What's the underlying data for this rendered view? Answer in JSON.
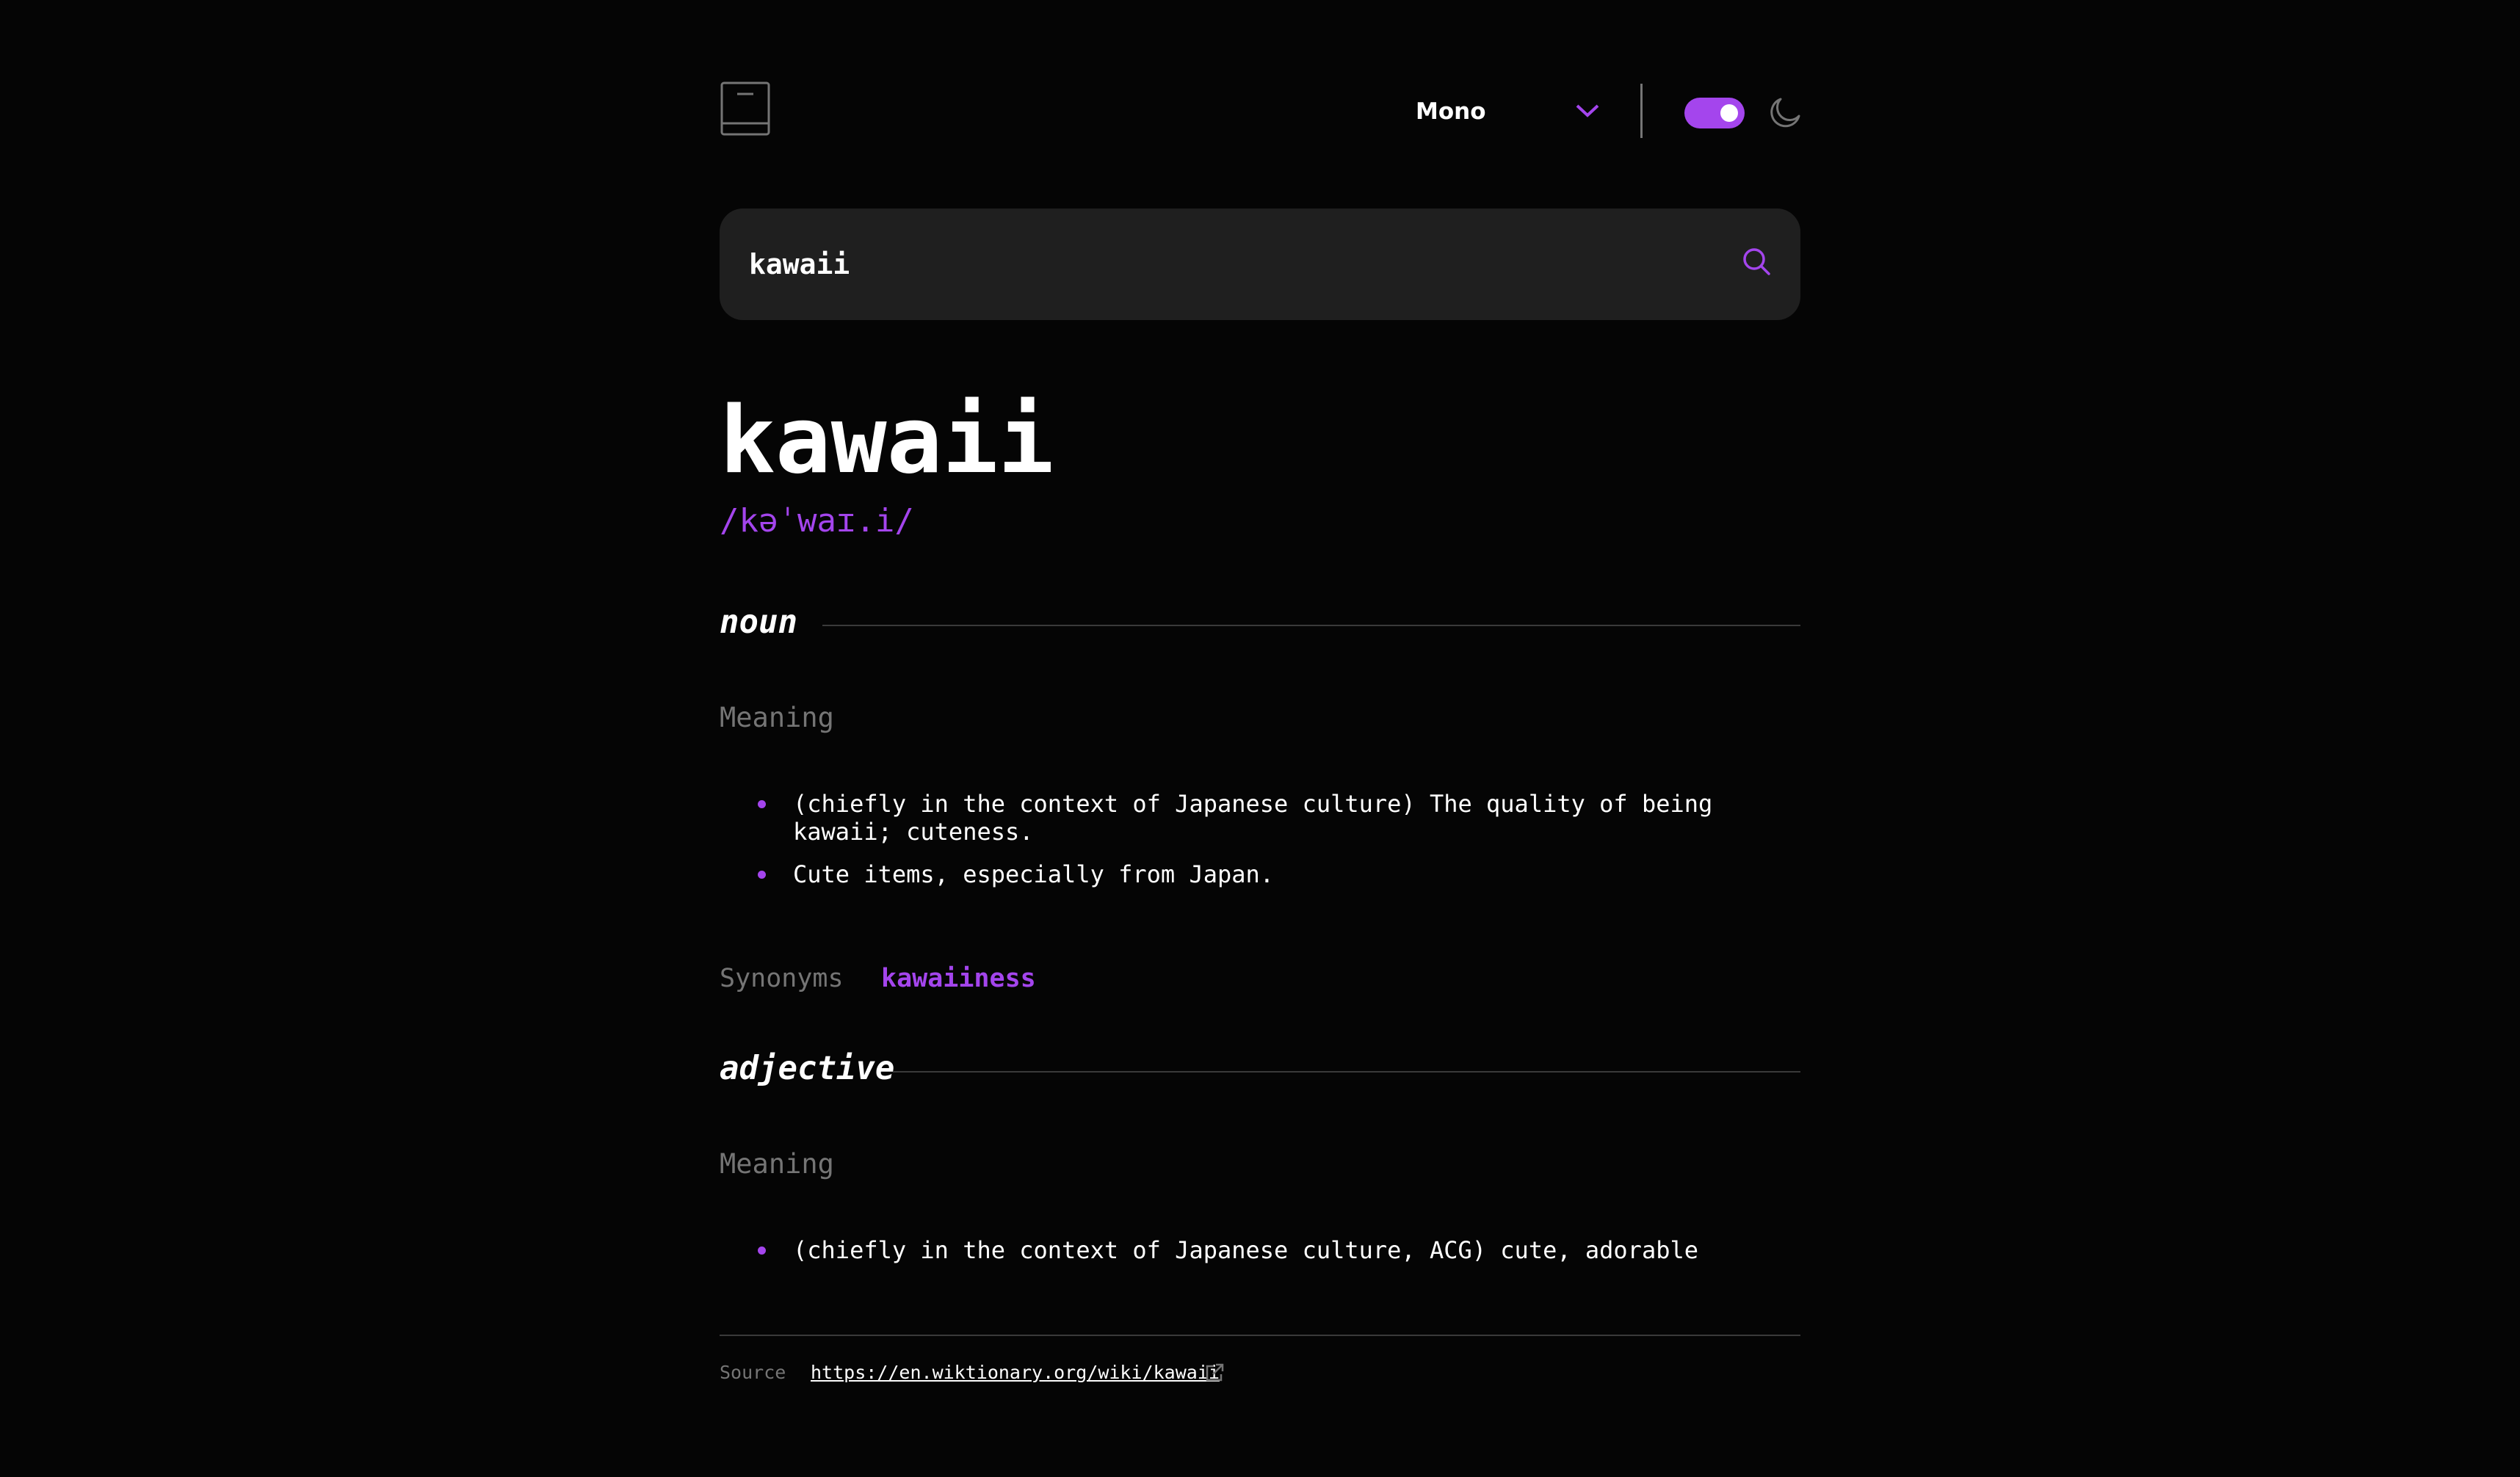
{
  "header": {
    "logo_icon": "book-icon",
    "font_selector": {
      "selected": "Mono",
      "icon": "chevron-down-icon"
    },
    "theme_toggle": {
      "state": "on",
      "icon": "moon-icon"
    }
  },
  "search": {
    "value": "kawaii",
    "icon": "search-icon"
  },
  "entry": {
    "word": "kawaii",
    "phonetic": "/kəˈwaɪ.i/",
    "meanings": [
      {
        "part_of_speech": "noun",
        "meaning_label": "Meaning",
        "definitions": [
          "(chiefly in the context of Japanese culture) The quality of being kawaii; cuteness.",
          "Cute items, especially from Japan."
        ],
        "synonyms_label": "Synonyms",
        "synonyms": [
          "kawaiiness"
        ]
      },
      {
        "part_of_speech": "adjective",
        "meaning_label": "Meaning",
        "definitions": [
          "(chiefly in the context of Japanese culture, ACG) cute, adorable"
        ]
      }
    ]
  },
  "footer": {
    "source_label": "Source",
    "source_url": "https://en.wiktionary.org/wiki/kawaii",
    "link_icon": "external-link-icon"
  },
  "colors": {
    "background": "#050505",
    "accent": "#a445ed",
    "muted": "#757575",
    "search_bg": "#1f1f1f",
    "divider": "#3a3a3a"
  }
}
